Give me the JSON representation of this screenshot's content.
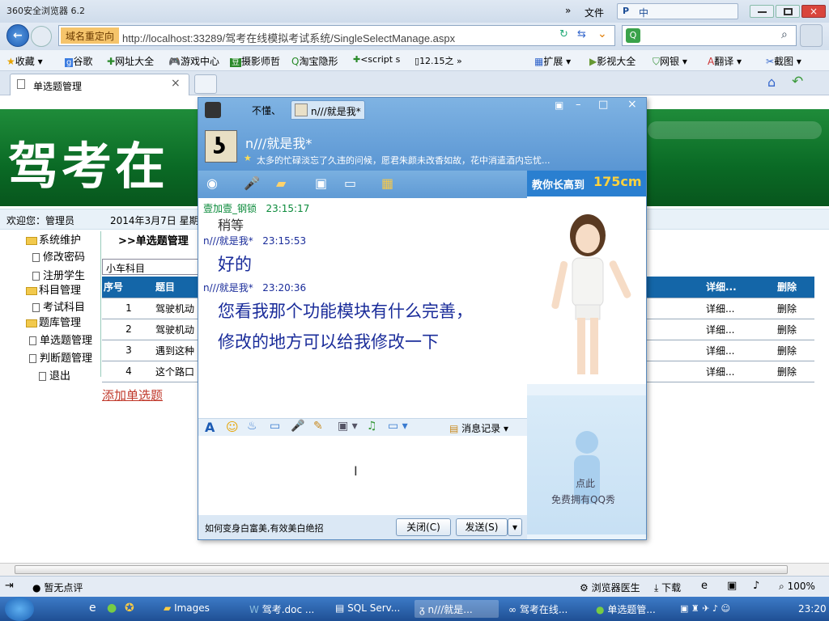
{
  "browser": {
    "title": "360安全浏览器 6.2",
    "menu_file": "文件",
    "tb_icon_labels": [
      "中"
    ],
    "redirect_label": "域名重定向",
    "url": "http://localhost:33289/驾考在线模拟考试系统/SingleSelectManage.aspx",
    "favorites": [
      "收藏",
      "谷歌",
      "网址大全",
      "游戏中心",
      "摄影师哲",
      "淘宝隐形",
      "<script s",
      "12.15之"
    ],
    "right_favorites": [
      "扩展",
      "影视大全",
      "网银",
      "翻译",
      "截图"
    ],
    "tab_title": "单选题管理",
    "close_glyph": "×"
  },
  "page": {
    "banner_text": "驾考在",
    "welcome": "欢迎您：管理员",
    "date": "2014年3月7日 星期",
    "tree": [
      {
        "type": "folder",
        "label": "系统维护"
      },
      {
        "type": "doc",
        "label": "修改密码"
      },
      {
        "type": "doc",
        "label": "注册学生"
      },
      {
        "type": "folder",
        "label": "科目管理"
      },
      {
        "type": "doc",
        "label": "考试科目"
      },
      {
        "type": "folder",
        "label": "题库管理"
      },
      {
        "type": "doc",
        "label": "单选题管理"
      },
      {
        "type": "doc",
        "label": "判断题管理"
      },
      {
        "type": "doc",
        "label": "退出"
      }
    ],
    "section_title": ">>单选题管理",
    "subject_select": "小车科目",
    "table_headers": {
      "no": "序号",
      "question": "题目",
      "detail": "详细...",
      "delete": "删除"
    },
    "rows": [
      {
        "no": "1",
        "question": "驾驶机动",
        "detail": "详细...",
        "delete": "删除"
      },
      {
        "no": "2",
        "question": "驾驶机动",
        "detail": "详细...",
        "delete": "删除"
      },
      {
        "no": "3",
        "question": "遇到这种",
        "detail": "详细...",
        "delete": "删除"
      },
      {
        "no": "4",
        "question": "这个路口",
        "detail": "详细...",
        "delete": "删除"
      }
    ],
    "add_link": "添加单选题"
  },
  "status": {
    "comment": "暂无点评",
    "doctor": "浏览器医生",
    "download": "下载",
    "zoom": "100%"
  },
  "taskbar": {
    "items": [
      "Images",
      "驾考.doc ...",
      "SQL Serv...",
      "n///就是...",
      "驾考在线...",
      "单选题管..."
    ],
    "clock": "23:20"
  },
  "qq": {
    "tab1": "不懂、",
    "tab2": "n///就是我*",
    "contact_name": "n///就是我*",
    "signature": "太多的忙碌淡忘了久违的问候，愿君朱颜未改香如故，花中消遣酒内忘忧...",
    "ad_text": "教你长高到",
    "ad_highlight": "175cm",
    "messages": [
      {
        "sender": "壹加壹_钢锁",
        "time": "23:15:17",
        "text": "稍等",
        "self": false
      },
      {
        "sender": "n///就是我*",
        "time": "23:15:53",
        "text": "好的",
        "self": true
      },
      {
        "sender": "n///就是我*",
        "time": "23:20:36",
        "lines": [
          "您看我那个功能模块有什么完善，",
          "修改的地方可以给我修改一下"
        ],
        "self": true
      }
    ],
    "history_label": "消息记录",
    "bottom_tip": "如何变身白富美,有效美白绝招",
    "close_btn": "关闭(C)",
    "send_btn": "发送(S)",
    "avatar_click": "点此",
    "avatar_promo": "免费拥有QQ秀"
  }
}
